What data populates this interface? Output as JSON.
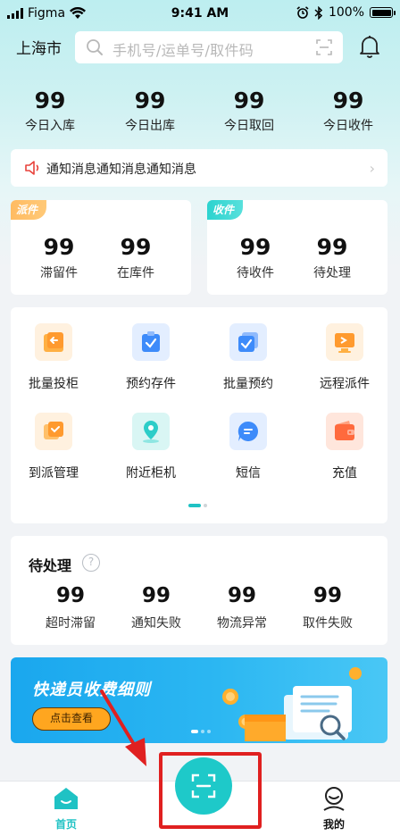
{
  "status_bar": {
    "carrier": "Figma",
    "time": "9:41 AM",
    "battery": "100%"
  },
  "header": {
    "city": "上海市",
    "search_placeholder": "手机号/运单号/取件码"
  },
  "stats": [
    {
      "value": "99",
      "label": "今日入库"
    },
    {
      "value": "99",
      "label": "今日出库"
    },
    {
      "value": "99",
      "label": "今日取回"
    },
    {
      "value": "99",
      "label": "今日收件"
    }
  ],
  "notice": {
    "text": "通知消息通知消息通知消息"
  },
  "dispatch_card": {
    "tag": "派件",
    "items": [
      {
        "value": "99",
        "label": "滞留件"
      },
      {
        "value": "99",
        "label": "在库件"
      }
    ]
  },
  "receive_card": {
    "tag": "收件",
    "items": [
      {
        "value": "99",
        "label": "待收件"
      },
      {
        "value": "99",
        "label": "待处理"
      }
    ]
  },
  "grid": [
    {
      "label": "批量投柜",
      "icon": "cabinet-drop-icon",
      "color": "#ffa23c"
    },
    {
      "label": "预约存件",
      "icon": "reserve-store-icon",
      "color": "#3d8bfa"
    },
    {
      "label": "批量预约",
      "icon": "batch-reserve-icon",
      "color": "#3d8bfa"
    },
    {
      "label": "远程派件",
      "icon": "remote-dispatch-icon",
      "color": "#ffa23c"
    },
    {
      "label": "到派管理",
      "icon": "arrival-manage-icon",
      "color": "#ffa23c"
    },
    {
      "label": "附近柜机",
      "icon": "location-pin-icon",
      "color": "#2ccdc8"
    },
    {
      "label": "短信",
      "icon": "sms-icon",
      "color": "#3d8bfa"
    },
    {
      "label": "充值",
      "icon": "wallet-icon",
      "color": "#ff6a3d"
    }
  ],
  "pending": {
    "title": "待处理",
    "items": [
      {
        "value": "99",
        "label": "超时滞留"
      },
      {
        "value": "99",
        "label": "通知失败"
      },
      {
        "value": "99",
        "label": "物流异常"
      },
      {
        "value": "99",
        "label": "取件失败"
      }
    ]
  },
  "banner": {
    "title": "快递员收费细则",
    "button": "点击查看"
  },
  "tabbar": {
    "home": "首页",
    "me": "我的"
  },
  "colors": {
    "accent": "#1fc2c4",
    "highlight": "#e02020"
  }
}
